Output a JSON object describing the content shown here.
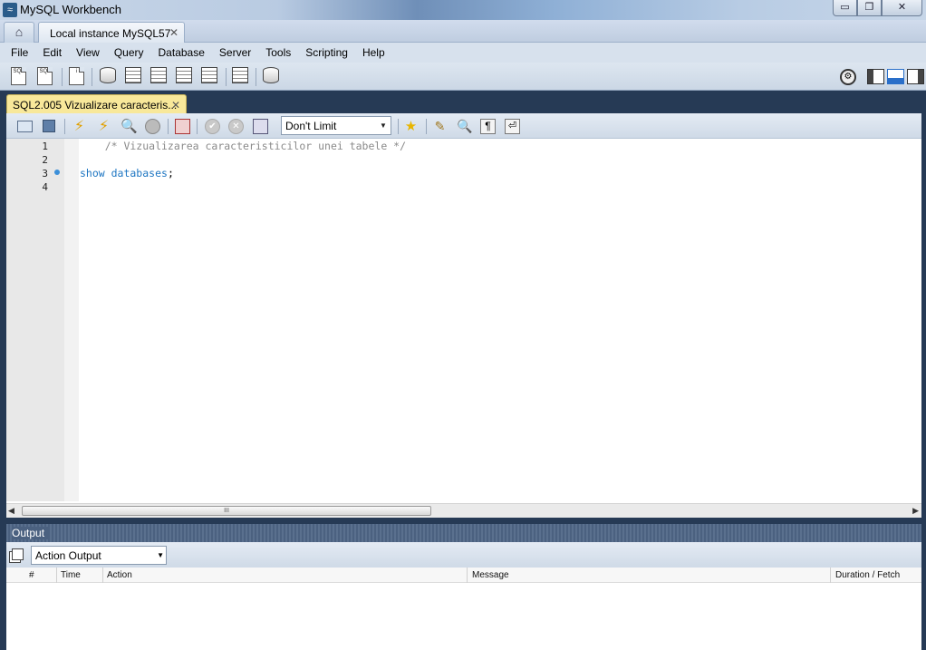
{
  "window": {
    "title": "MySQL Workbench",
    "buttons": {
      "minimize": "▭",
      "restore": "❐",
      "close": "✕"
    }
  },
  "tabs": {
    "home_icon": "home-icon",
    "connection_tab_label": "Local instance MySQL57",
    "close_glyph": "✕"
  },
  "menu": [
    "File",
    "Edit",
    "View",
    "Query",
    "Database",
    "Server",
    "Tools",
    "Scripting",
    "Help"
  ],
  "query_tab": {
    "label": "SQL2.005 Vizualizare caracteris...",
    "close_glyph": "✕"
  },
  "query_toolbar": {
    "limit_value": "Don't Limit"
  },
  "editor": {
    "line_numbers": [
      "1",
      "2",
      "3",
      "4"
    ],
    "lines": {
      "comment": "    /* Vizualizarea caracteristicilor unei tabele */",
      "keyword": "show databases",
      "terminator": ";"
    }
  },
  "scrollbar": {
    "left_arrow": "◀",
    "right_arrow": "▶",
    "thumb_grip": "III"
  },
  "output": {
    "header": "Output",
    "selector_value": "Action Output",
    "columns": [
      "#",
      "Time",
      "Action",
      "Message",
      "Duration / Fetch"
    ]
  },
  "colors": {
    "accent": "#2a6fc9",
    "query_tab": "#f8e89a",
    "keyword": "#1e76c2",
    "comment": "#8a8a8a"
  }
}
